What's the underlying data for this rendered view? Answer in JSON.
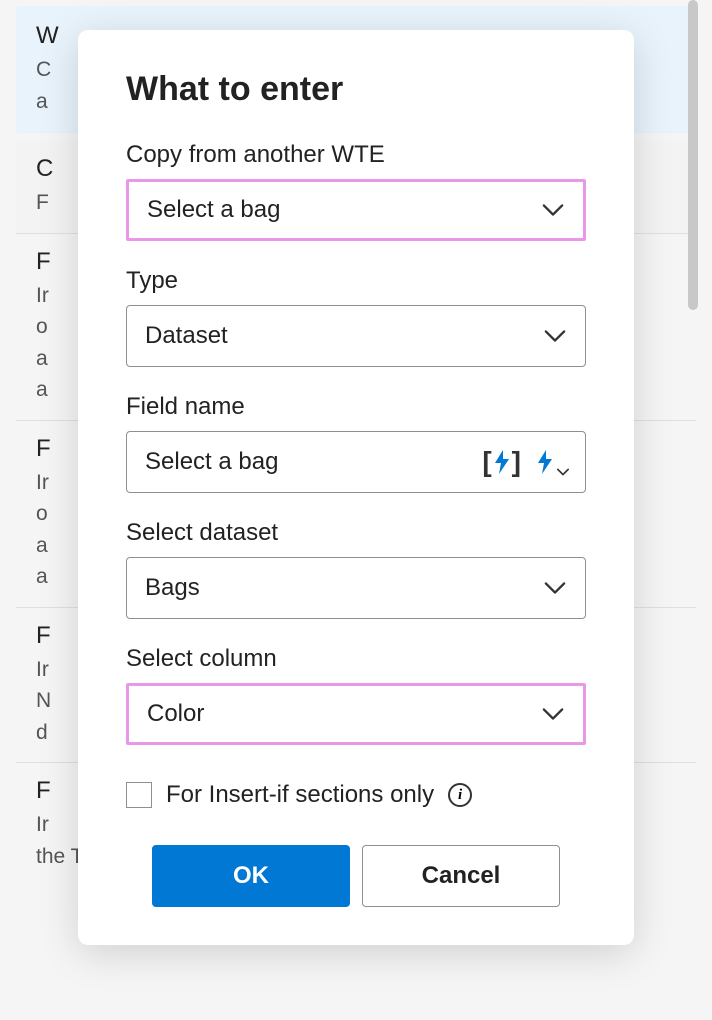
{
  "background": {
    "sections": [
      {
        "letter": "W",
        "text1": "C",
        "text2": "a"
      },
      {
        "letter": "C",
        "text1": "F"
      },
      {
        "letter": "F",
        "text1": "Ir",
        "text2": "o",
        "text3": "a",
        "text4": "a"
      },
      {
        "letter": "F",
        "text1": "Ir",
        "text2": "o",
        "text3": "a",
        "text4": "a"
      },
      {
        "letter": "F",
        "text1": "Ir",
        "text2": "N",
        "text3": "d"
      },
      {
        "letter": "F",
        "text1": "Ir",
        "bottom": "the Title field of an appointment. If the field"
      }
    ]
  },
  "modal": {
    "title": "What to enter",
    "fields": {
      "copy_from": {
        "label": "Copy from another WTE",
        "value": "Select a bag"
      },
      "type": {
        "label": "Type",
        "value": "Dataset"
      },
      "field_name": {
        "label": "Field name",
        "value": "Select a bag"
      },
      "select_dataset": {
        "label": "Select dataset",
        "value": "Bags"
      },
      "select_column": {
        "label": "Select column",
        "value": "Color"
      }
    },
    "checkbox": {
      "label": "For Insert-if sections only",
      "checked": false
    },
    "buttons": {
      "ok": "OK",
      "cancel": "Cancel"
    }
  }
}
